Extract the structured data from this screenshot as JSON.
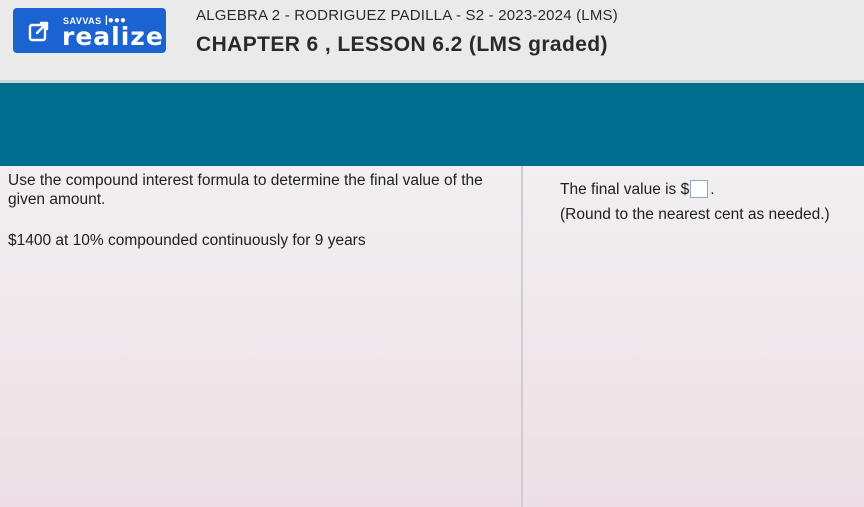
{
  "header": {
    "brand_small": "SAVVAS",
    "brand_dots": "|●●●",
    "brand_name": "realize",
    "course_title": "ALGEBRA 2 - RODRIGUEZ PADILLA - S2 - 2023-2024 (LMS)",
    "chapter_title": "CHAPTER 6 , LESSON 6.2 (LMS graded)",
    "icons": [
      "external-link-icon"
    ]
  },
  "question": {
    "instruction": "Use the compound interest formula to determine the final value of the given amount.",
    "problem": "$1400 at 10% compounded continuously for 9 years"
  },
  "answer": {
    "prefix": "The final value is $",
    "value": "",
    "suffix": ".",
    "hint": "(Round to the nearest cent as needed.)"
  },
  "colors": {
    "brand_blue": "#1a63d1",
    "banner_teal": "#006e8e",
    "text": "#202020"
  }
}
